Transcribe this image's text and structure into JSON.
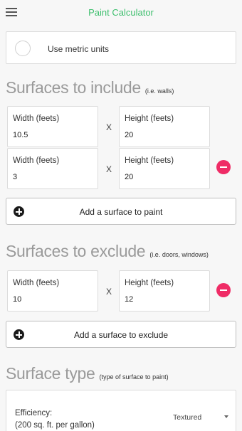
{
  "header": {
    "title": "Paint Calculator",
    "menu_icon": "hamburger-menu-icon"
  },
  "units": {
    "label": "Use metric units",
    "checked": false
  },
  "include_section": {
    "title": "Surfaces to include",
    "hint": "(i.e. walls)",
    "surfaces": [
      {
        "width_label": "Width (feets)",
        "width_value": "10.5",
        "height_label": "Height (feets)",
        "height_value": "20",
        "separator": "X"
      },
      {
        "width_label": "Width (feets)",
        "width_value": "3",
        "height_label": "Height (feets)",
        "height_value": "20",
        "separator": "X"
      }
    ],
    "add_label": "Add a surface to paint"
  },
  "exclude_section": {
    "title": "Surfaces to exclude",
    "hint": "(i.e. doors, windows)",
    "surfaces": [
      {
        "width_label": "Width (feets)",
        "width_value": "10",
        "height_label": "Height (feets)",
        "height_value": "12",
        "separator": "X"
      }
    ],
    "add_label": "Add a surface to exclude"
  },
  "surface_type_section": {
    "title": "Surface type",
    "hint": "(type of surface to paint)",
    "efficiency_label_line1": "Efficiency:",
    "efficiency_label_line2": "(200 sq. ft. per gallon)",
    "selected_value": "Textured"
  },
  "colors": {
    "title_green": "#3ebf6e",
    "remove_pink": "#ef2c66",
    "section_grey": "#9a9a9a"
  }
}
